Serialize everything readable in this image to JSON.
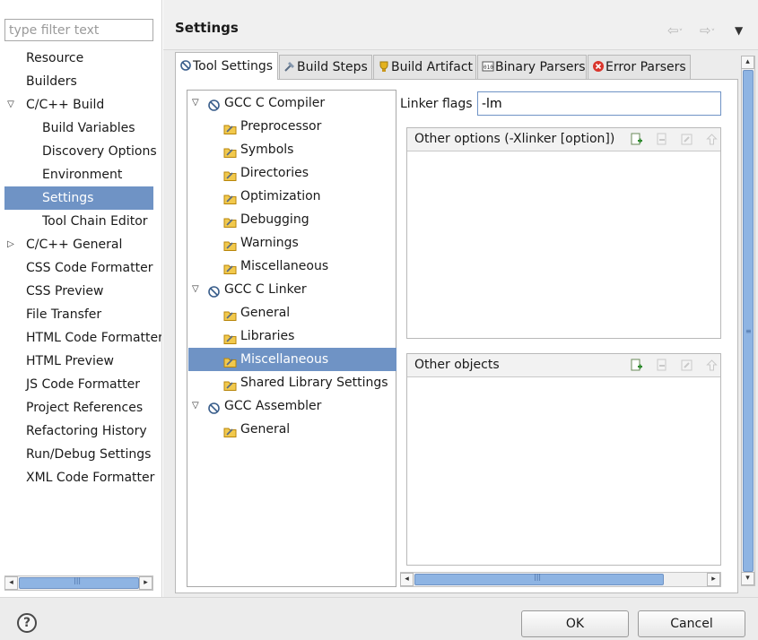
{
  "filter": {
    "placeholder": "type filter text"
  },
  "nav": {
    "items": [
      {
        "label": "Resource",
        "level": 1,
        "arrow": ""
      },
      {
        "label": "Builders",
        "level": 1,
        "arrow": ""
      },
      {
        "label": "C/C++ Build",
        "level": 1,
        "arrow": "expanded"
      },
      {
        "label": "Build Variables",
        "level": 2,
        "arrow": ""
      },
      {
        "label": "Discovery Options",
        "level": 2,
        "arrow": ""
      },
      {
        "label": "Environment",
        "level": 2,
        "arrow": ""
      },
      {
        "label": "Settings",
        "level": 2,
        "arrow": "",
        "selected": true
      },
      {
        "label": "Tool Chain Editor",
        "level": 2,
        "arrow": ""
      },
      {
        "label": "C/C++ General",
        "level": 1,
        "arrow": "collapsed"
      },
      {
        "label": "CSS Code Formatter",
        "level": 1,
        "arrow": ""
      },
      {
        "label": "CSS Preview",
        "level": 1,
        "arrow": ""
      },
      {
        "label": "File Transfer",
        "level": 1,
        "arrow": ""
      },
      {
        "label": "HTML Code Formatter",
        "level": 1,
        "arrow": ""
      },
      {
        "label": "HTML Preview",
        "level": 1,
        "arrow": ""
      },
      {
        "label": "JS Code Formatter",
        "level": 1,
        "arrow": ""
      },
      {
        "label": "Project References",
        "level": 1,
        "arrow": ""
      },
      {
        "label": "Refactoring History",
        "level": 1,
        "arrow": ""
      },
      {
        "label": "Run/Debug Settings",
        "level": 1,
        "arrow": ""
      },
      {
        "label": "XML Code Formatter",
        "level": 1,
        "arrow": ""
      }
    ]
  },
  "header": {
    "title": "Settings"
  },
  "tabs": [
    {
      "label": "Tool Settings",
      "icon": "tool-settings-icon",
      "active": true
    },
    {
      "label": "Build Steps",
      "icon": "build-steps-icon",
      "active": false
    },
    {
      "label": "Build Artifact",
      "icon": "build-artifact-icon",
      "active": false
    },
    {
      "label": "Binary Parsers",
      "icon": "binary-parsers-icon",
      "active": false
    },
    {
      "label": "Error Parsers",
      "icon": "error-parsers-icon",
      "active": false
    }
  ],
  "tool_tree": [
    {
      "label": "GCC C Compiler",
      "level": 0,
      "arrow": "expanded",
      "icon": "gcc-tool-icon"
    },
    {
      "label": "Preprocessor",
      "level": 1,
      "icon": "option-category-icon"
    },
    {
      "label": "Symbols",
      "level": 1,
      "icon": "option-category-icon"
    },
    {
      "label": "Directories",
      "level": 1,
      "icon": "option-category-icon"
    },
    {
      "label": "Optimization",
      "level": 1,
      "icon": "option-category-icon"
    },
    {
      "label": "Debugging",
      "level": 1,
      "icon": "option-category-icon"
    },
    {
      "label": "Warnings",
      "level": 1,
      "icon": "option-category-icon"
    },
    {
      "label": "Miscellaneous",
      "level": 1,
      "icon": "option-category-icon"
    },
    {
      "label": "GCC C Linker",
      "level": 0,
      "arrow": "expanded",
      "icon": "gcc-tool-icon"
    },
    {
      "label": "General",
      "level": 1,
      "icon": "option-category-icon"
    },
    {
      "label": "Libraries",
      "level": 1,
      "icon": "option-category-icon"
    },
    {
      "label": "Miscellaneous",
      "level": 1,
      "icon": "option-category-icon",
      "selected": true
    },
    {
      "label": "Shared Library Settings",
      "level": 1,
      "icon": "option-category-icon"
    },
    {
      "label": "GCC Assembler",
      "level": 0,
      "arrow": "expanded",
      "icon": "gcc-tool-icon"
    },
    {
      "label": "General",
      "level": 1,
      "icon": "option-category-icon"
    }
  ],
  "options": {
    "linker_flags_label": "Linker flags",
    "linker_flags_value": "-lm",
    "other_options_title": "Other options (-Xlinker [option])",
    "other_objects_title": "Other objects",
    "list_tools": [
      "add-icon",
      "delete-icon",
      "edit-icon",
      "move-up-icon"
    ]
  },
  "buttons": {
    "help": "?",
    "ok": "OK",
    "cancel": "Cancel"
  },
  "colors": {
    "selection": "#6f93c5",
    "scroll_thumb": "#8eb4e3"
  }
}
